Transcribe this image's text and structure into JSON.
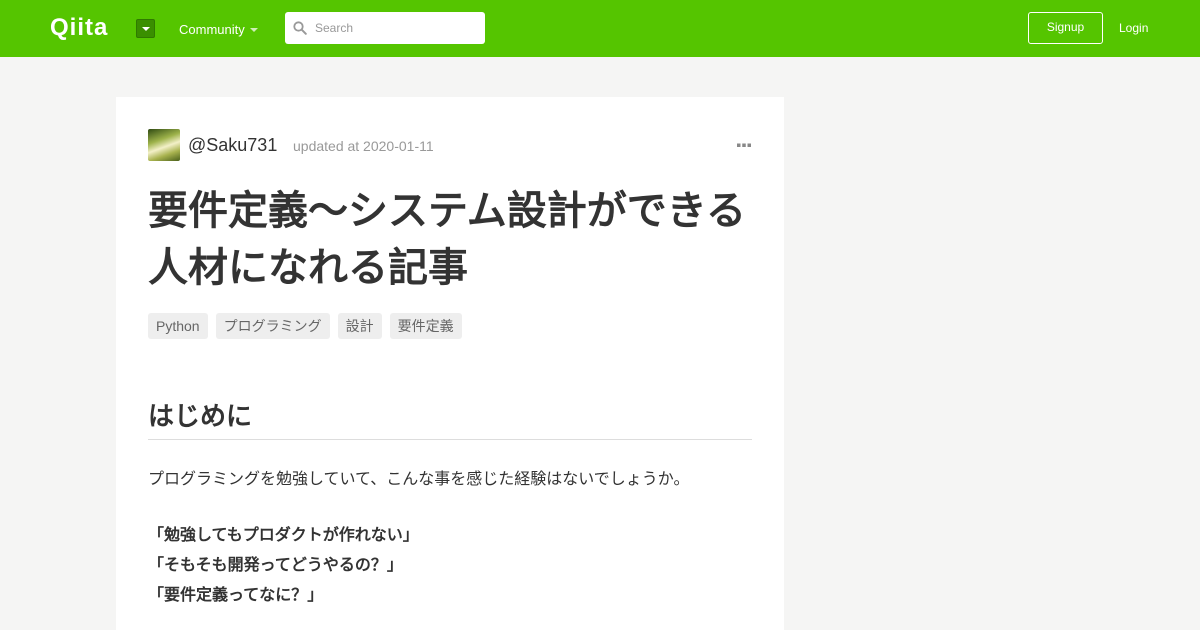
{
  "header": {
    "logo": "Qiita",
    "community_label": "Community",
    "search_placeholder": "Search",
    "signup_label": "Signup",
    "login_label": "Login",
    "brand_color": "#55c500"
  },
  "article": {
    "author": "@Saku731",
    "updated": "updated at 2020-01-11",
    "title": "要件定義～システム設計ができる人材になれる記事",
    "tags": [
      "Python",
      "プログラミング",
      "設計",
      "要件定義"
    ],
    "heading": "はじめに",
    "paragraph": "プログラミングを勉強していて、こんな事を感じた経験はないでしょうか。",
    "quotes": [
      "「勉強してもプロダクトが作れない」",
      "「そもそも開発ってどうやるの？」",
      "「要件定義ってなに？」"
    ]
  }
}
